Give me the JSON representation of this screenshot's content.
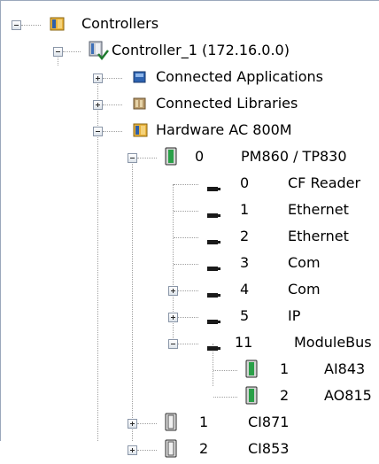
{
  "tree": {
    "controllers": "Controllers",
    "controller": "Controller_1 (172.16.0.0)",
    "connected_applications": "Connected Applications",
    "connected_libraries": "Connected Libraries",
    "hardware": "Hardware  AC 800M",
    "pm_unit": {
      "pos": "0",
      "name": "PM860 / TP830"
    },
    "ports": [
      {
        "pos": "0",
        "name": "CF Reader"
      },
      {
        "pos": "1",
        "name": "Ethernet"
      },
      {
        "pos": "2",
        "name": "Ethernet"
      },
      {
        "pos": "3",
        "name": "Com"
      },
      {
        "pos": "4",
        "name": "Com"
      },
      {
        "pos": "5",
        "name": "IP"
      },
      {
        "pos": "11",
        "name": "ModuleBus"
      }
    ],
    "modulebus_units": [
      {
        "pos": "1",
        "name": "AI843"
      },
      {
        "pos": "2",
        "name": "AO815"
      }
    ],
    "ci_units": [
      {
        "pos": "1",
        "name": "CI871"
      },
      {
        "pos": "2",
        "name": "CI853"
      }
    ]
  }
}
